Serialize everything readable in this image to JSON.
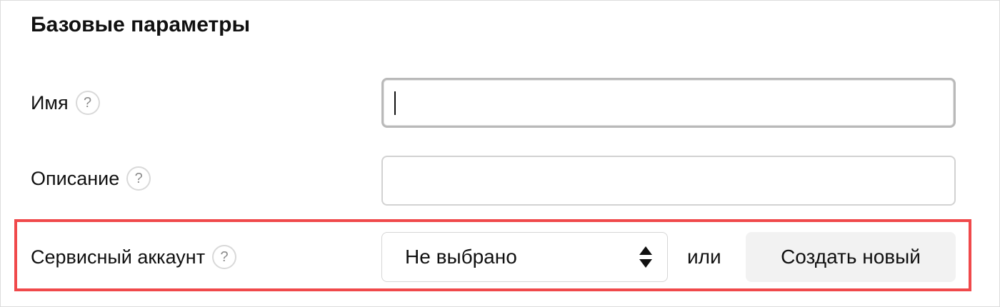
{
  "section": {
    "title": "Базовые параметры"
  },
  "fields": {
    "name": {
      "label": "Имя",
      "help": "?",
      "value": "",
      "placeholder": ""
    },
    "description": {
      "label": "Описание",
      "help": "?",
      "value": "",
      "placeholder": ""
    },
    "service_account": {
      "label": "Сервисный аккаунт",
      "help": "?",
      "selected": "Не выбрано",
      "or_text": "или",
      "create_label": "Создать новый"
    }
  },
  "colors": {
    "highlight": "#f0494b",
    "button_bg": "#f2f2f2",
    "border": "#d2d2d2"
  },
  "icons": {
    "help": "question-circle-icon",
    "select_arrows": "sort-arrows-icon"
  }
}
